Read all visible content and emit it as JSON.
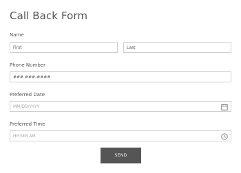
{
  "form": {
    "title": "Call Back Form",
    "name": {
      "label": "Name",
      "first": "First",
      "last": "Last"
    },
    "phone": {
      "label": "Phone Number",
      "value": "### ###-####"
    },
    "date": {
      "label": "Preferred Date",
      "placeholder": "MM/DD/YYYY",
      "icon": "calendar-icon"
    },
    "time": {
      "label": "Preferred Time",
      "placeholder": "HH:MM AM",
      "icon": "clock-icon"
    },
    "send_label": "SEND"
  },
  "colors": {
    "text": "#555555",
    "placeholder": "#a8a8a8",
    "border": "#cfcfcf",
    "button": "#555555",
    "button_text": "#f2f2f2"
  }
}
